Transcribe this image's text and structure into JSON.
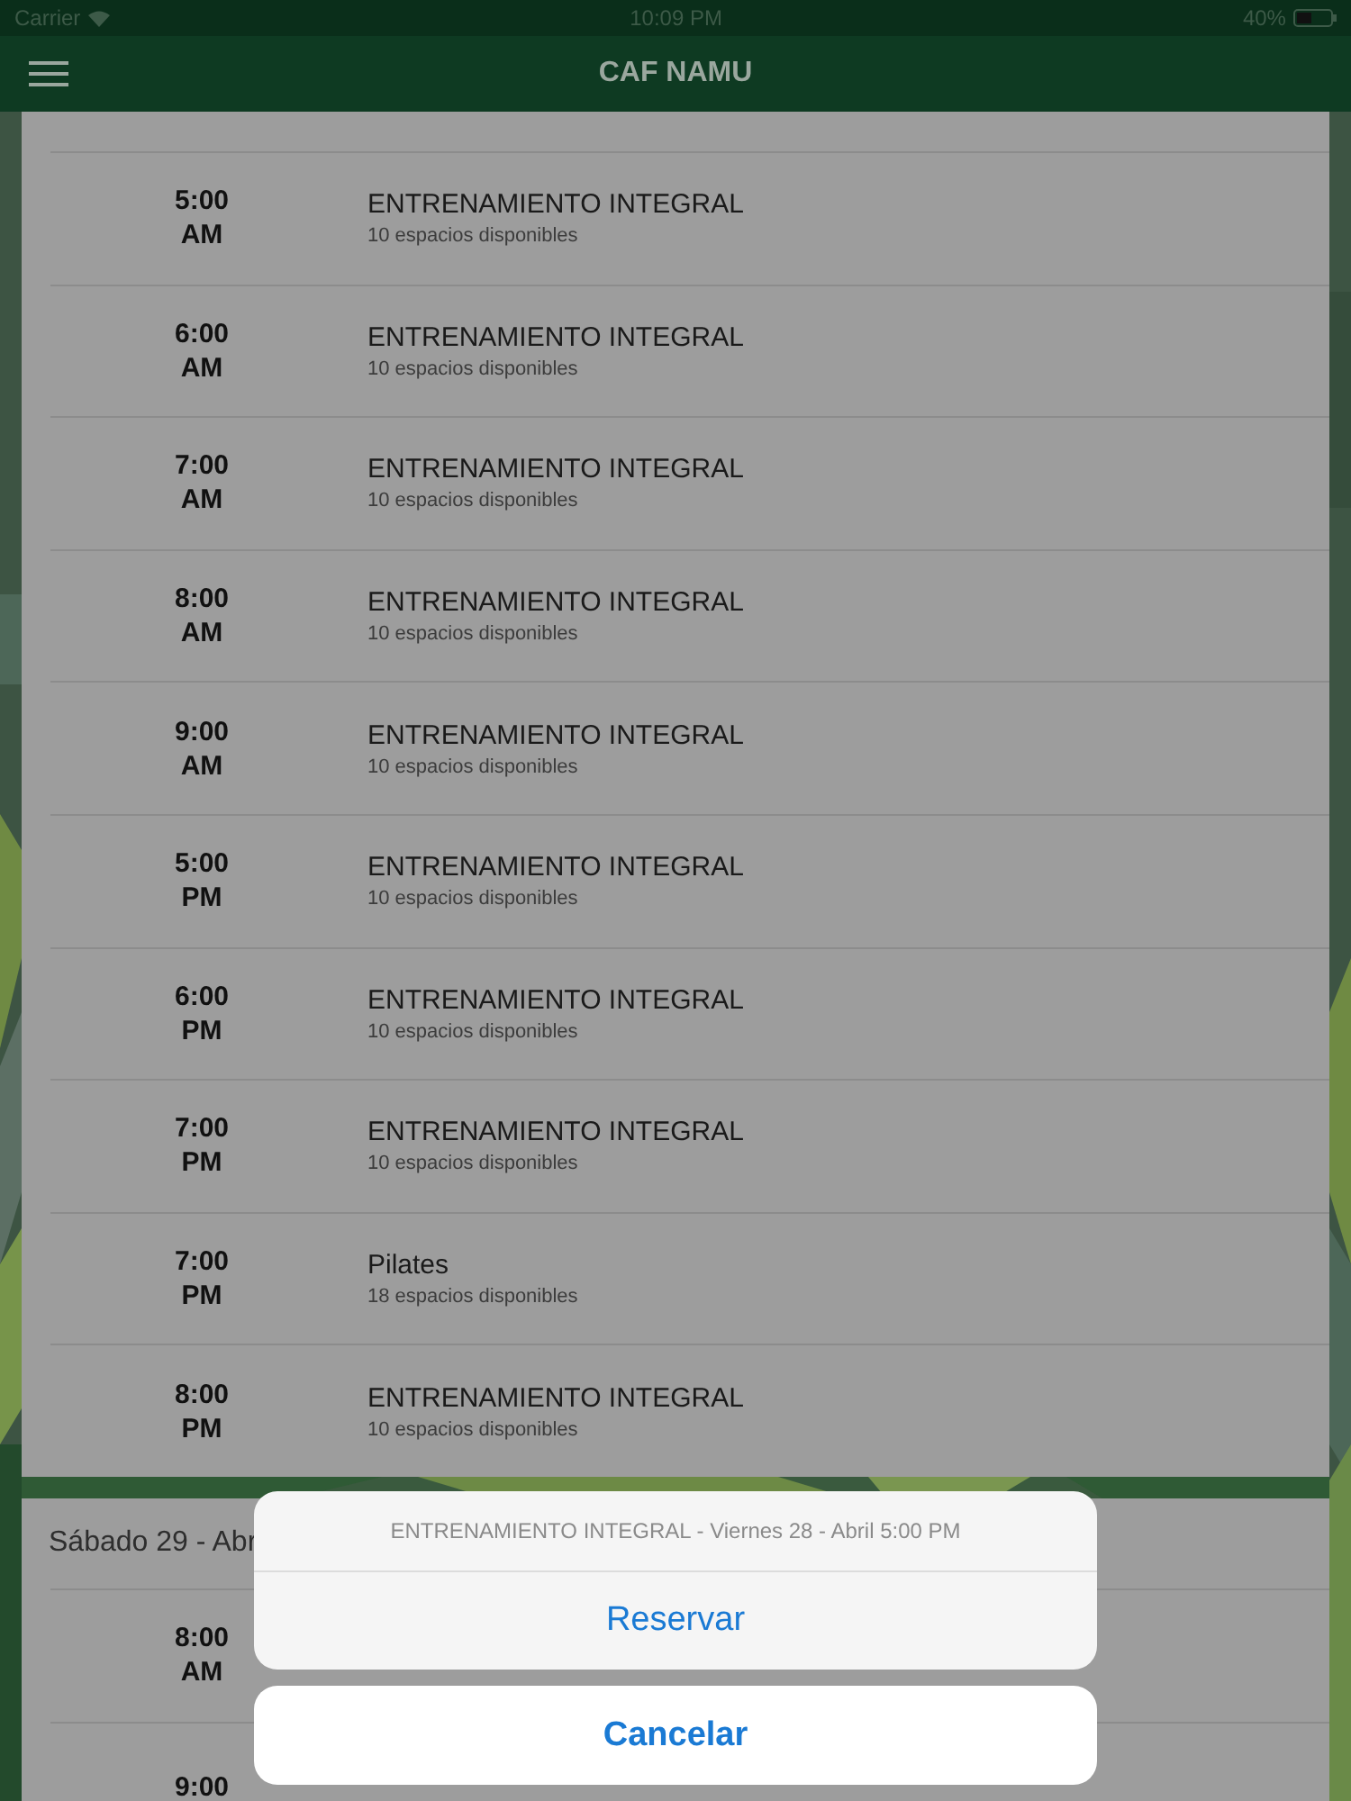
{
  "status_bar": {
    "carrier": "Carrier",
    "time": "10:09 PM",
    "battery": "40%"
  },
  "nav": {
    "title": "CAF NAMU"
  },
  "days": [
    {
      "rows": [
        {
          "time": "5:00",
          "period": "AM",
          "title": "ENTRENAMIENTO INTEGRAL",
          "subtitle": "10 espacios disponibles"
        },
        {
          "time": "6:00",
          "period": "AM",
          "title": "ENTRENAMIENTO INTEGRAL",
          "subtitle": "10 espacios disponibles"
        },
        {
          "time": "7:00",
          "period": "AM",
          "title": "ENTRENAMIENTO INTEGRAL",
          "subtitle": "10 espacios disponibles"
        },
        {
          "time": "8:00",
          "period": "AM",
          "title": "ENTRENAMIENTO INTEGRAL",
          "subtitle": "10 espacios disponibles"
        },
        {
          "time": "9:00",
          "period": "AM",
          "title": "ENTRENAMIENTO INTEGRAL",
          "subtitle": "10 espacios disponibles"
        },
        {
          "time": "5:00",
          "period": "PM",
          "title": "ENTRENAMIENTO INTEGRAL",
          "subtitle": "10 espacios disponibles"
        },
        {
          "time": "6:00",
          "period": "PM",
          "title": "ENTRENAMIENTO INTEGRAL",
          "subtitle": "10 espacios disponibles"
        },
        {
          "time": "7:00",
          "period": "PM",
          "title": "ENTRENAMIENTO INTEGRAL",
          "subtitle": "10 espacios disponibles"
        },
        {
          "time": "7:00",
          "period": "PM",
          "title": "Pilates",
          "subtitle": "18 espacios disponibles"
        },
        {
          "time": "8:00",
          "period": "PM",
          "title": "ENTRENAMIENTO INTEGRAL",
          "subtitle": "10 espacios disponibles"
        }
      ]
    },
    {
      "header": "Sábado 29 - Abr",
      "rows": [
        {
          "time": "8:00",
          "period": "AM"
        },
        {
          "time": "9:00"
        }
      ]
    }
  ],
  "action_sheet": {
    "message": "ENTRENAMIENTO INTEGRAL - Viernes 28 - Abril 5:00 PM",
    "actions": [
      "Reservar"
    ],
    "cancel": "Cancelar"
  }
}
